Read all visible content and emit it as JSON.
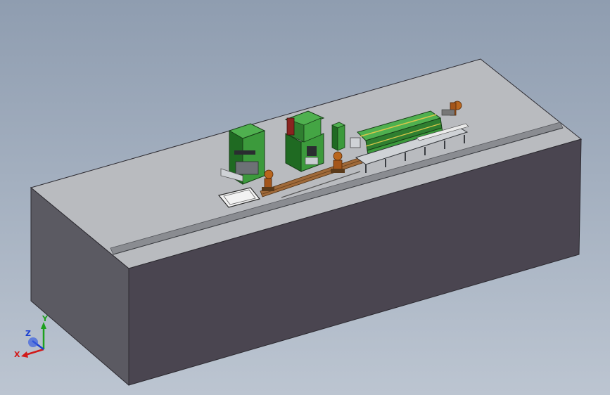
{
  "viewport": {
    "background_top": "#8f9db0",
    "background_bottom": "#bcc5d1"
  },
  "colors": {
    "platform_top": "#b9bbbf",
    "platform_front": "#4a4550",
    "platform_left": "#5b5a62",
    "platform_edge": "#2c2a30",
    "machine_green": "#3c9a3c",
    "machine_green_dark": "#1f6a22",
    "robot_orange": "#b9661e",
    "rail": "#a06a3a",
    "frame_dark": "#3a3d42",
    "accent_yellow": "#d8c64a"
  },
  "triad": {
    "x_label": "X",
    "y_label": "Y",
    "z_label": "Z",
    "x_color": "#d11a1a",
    "y_color": "#1da01d",
    "z_color": "#1a3fd1"
  },
  "icons": {
    "triad": "axis-triad-icon"
  }
}
